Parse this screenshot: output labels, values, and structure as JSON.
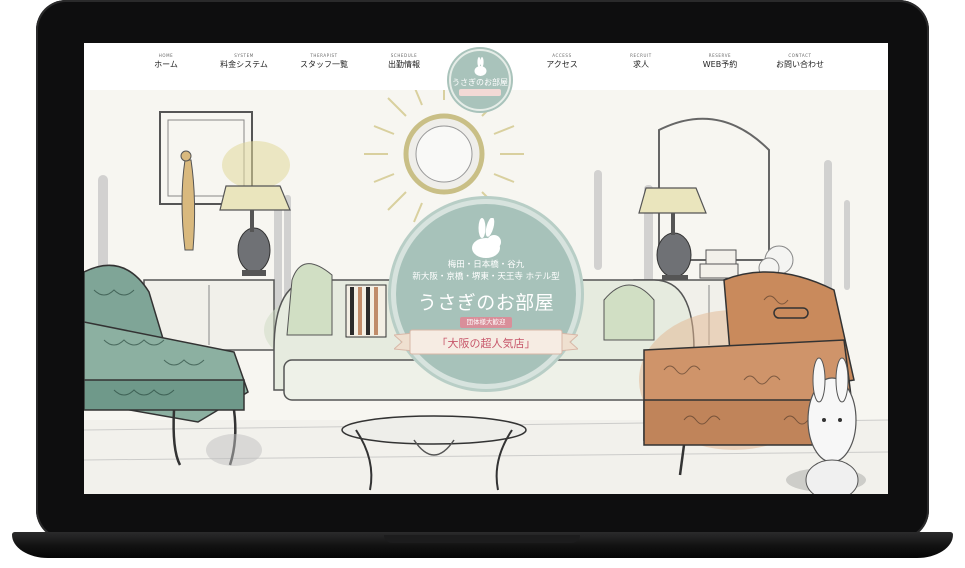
{
  "nav": {
    "items": [
      {
        "en": "HOME",
        "jp": "ホーム"
      },
      {
        "en": "SYSTEM",
        "jp": "料金システム"
      },
      {
        "en": "THERAPIST",
        "jp": "スタッフ一覧"
      },
      {
        "en": "SCHEDULE",
        "jp": "出勤情報"
      },
      {
        "en": "ACCESS",
        "jp": "アクセス"
      },
      {
        "en": "RECRUIT",
        "jp": "求人"
      },
      {
        "en": "RESERVE",
        "jp": "WEB予約"
      },
      {
        "en": "CONTACT",
        "jp": "お問い合わせ"
      }
    ],
    "logo_text": "うさぎのお部屋"
  },
  "hero": {
    "areas_line1": "梅田・日本橋・谷九",
    "areas_line2": "新大阪・京橋・堺東・天王寺 ホテル型",
    "brand": "うさぎのお部屋",
    "badge": "団体様大歓迎",
    "tagline": "「大阪の超人気店」"
  },
  "colors": {
    "accent_sage": "#a7c2ba",
    "accent_pink": "#d98f9a",
    "chair_green": "#7fa597",
    "chair_orange": "#c98a5c",
    "lamp_cream": "#e9e3b8"
  }
}
